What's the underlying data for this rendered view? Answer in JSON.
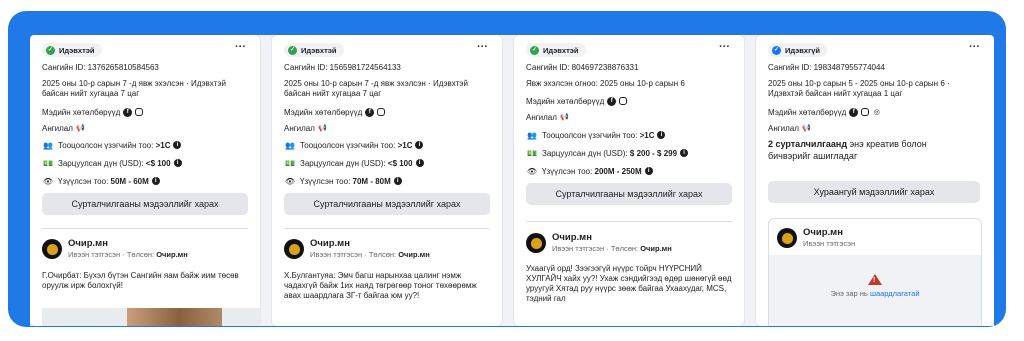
{
  "cards": [
    {
      "status": "Идэвхтэй",
      "library_id": "Сангийн ID: 1376265810584563",
      "date_line1": "2025 оны 10-р сарын 7 -д явж эхэлсэн · Идэвхтэй",
      "date_line2": "байсан нийт хугацаа 7 цаг",
      "platforms_label": "Мэдийн хөтөлбөрүүд",
      "category_label": "Ангилал",
      "audience_label": "Тооцоолсон үзэгчийн тоо:",
      "audience_value": ">1С",
      "spend_label": "Зарцуулсан дүн (USD):",
      "spend_value": "<$ 100",
      "impressions_label": "Үзүүлсэн тоо:",
      "impressions_value": "50M - 60M",
      "button": "Сурталчилгааны мэдээллийг харах",
      "page_name": "Очир.мн",
      "page_sub": "Ивээн тэтгэсэн",
      "paid_by_label": "Төлсөн:",
      "paid_by": "Очир.мн",
      "post_text": "Г.Очирбат: Бүхэл бүтэн Сангийн яам байж иим төсөв оруулж ирж болохгүй!"
    },
    {
      "status": "Идэвхтэй",
      "library_id": "Сангийн ID: 1565981724564133",
      "date_line1": "2025 оны 10-р сарын 7 -д явж эхэлсэн · Идэвхтэй",
      "date_line2": "байсан нийт хугацаа 7 цаг",
      "platforms_label": "Мэдийн хөтөлбөрүүд",
      "category_label": "Ангилал",
      "audience_label": "Тооцоолсон үзэгчийн тоо:",
      "audience_value": ">1С",
      "spend_label": "Зарцуулсан дүн (USD):",
      "spend_value": "<$ 100",
      "impressions_label": "Үзүүлсэн тоо:",
      "impressions_value": "70M - 80M",
      "button": "Сурталчилгааны мэдээллийг харах",
      "page_name": "Очир.мн",
      "page_sub": "Ивээн тэтгэсэн",
      "paid_by_label": "Төлсөн:",
      "paid_by": "Очир.мн",
      "post_text": "Х.Булгантуяа: Эмч багш нарынхаа цалинг нэмж чадахгүй байж 1их наяд төгрөгөөр тоног төхөөрөмж авах шаардлага ЗГ-т байгаа юм уу?!"
    },
    {
      "status": "Идэвхтэй",
      "library_id": "Сангийн ID: 804697238876331",
      "date_line1": "Явж эхэлсэн огноо: 2025 оны 10-р сарын 6",
      "platforms_label": "Мэдийн хөтөлбөрүүд",
      "category_label": "Ангилал",
      "audience_label": "Тооцоолсон үзэгчийн тоо:",
      "audience_value": ">1С",
      "spend_label": "Зарцуулсан дүн (USD):",
      "spend_value": "$ 200 - $ 299",
      "impressions_label": "Үзүүлсэн тоо:",
      "impressions_value": "200M - 250M",
      "button": "Сурталчилгааны мэдээллийг харах",
      "page_name": "Очир.мн",
      "page_sub": "Ивээн тэтгэсэн",
      "paid_by_label": "Төлсөн:",
      "paid_by": "Очир.мн",
      "post_text": "Ухаагүй орд! Зээгээгүй нүүрс тойрч НҮҮРСНИЙ ХУЛГАЙЧ хайх уу?! Ухаж сэндийгээд өдөр шөнөгүй өөд уруугуй Хятад руу нүүрс зөөж байгаа Ухаахудаг, MCS, тэдний гал"
    },
    {
      "status": "Идэвхгүй",
      "library_id": "Сангийн ID: 1983487955774044",
      "date_line1": "2025 оны 10-р сарын 5 - 2025 оны 10-р сарын 6 ·",
      "date_line2": "Идэвхтэй байсан нийт хугацаа 1 цаг",
      "platforms_label": "Мэдийн хөтөлбөрүүд",
      "category_label": "Ангилал",
      "creatives_bold": "2 сурталчилгаанд",
      "creatives_rest": "энэ креатив болон",
      "creatives_line2": "бичвэрийг ашигладаг",
      "button": "Хураангуй мэдээллийг харах",
      "page_name": "Очир.мн",
      "page_sub": "Ивээн тэтгэсэн",
      "warning_prefix": "Энэ зар нь",
      "warning_link": "шаардлагатай"
    }
  ],
  "colors": {
    "frame": "#1f7ae8",
    "active": "#31a24c",
    "inactive": "#1877f2",
    "warning": "#c0392b"
  }
}
